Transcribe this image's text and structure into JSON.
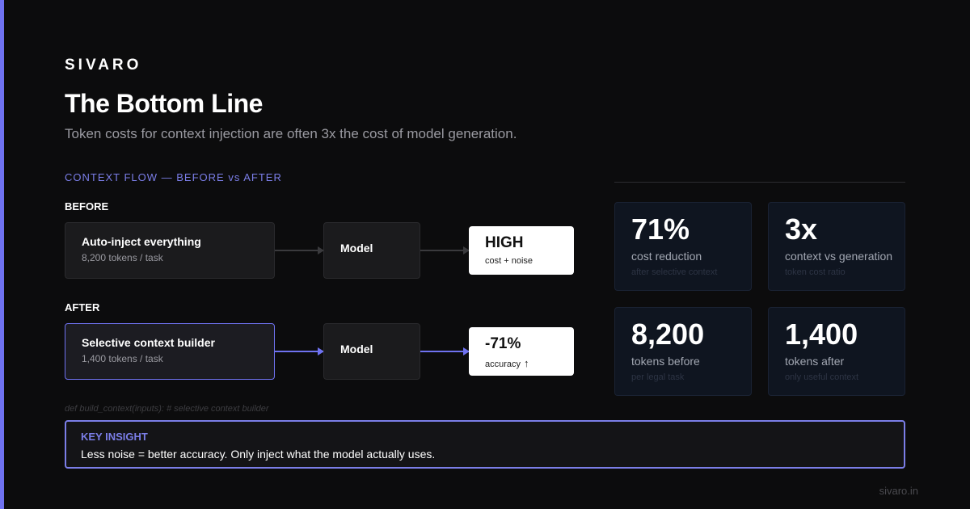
{
  "brand": "SIVARO",
  "title": "The Bottom Line",
  "subtitle": "Token costs for context injection are often 3x the cost of model generation.",
  "flow": {
    "section_label": "CONTEXT FLOW — BEFORE vs AFTER",
    "before": {
      "label": "BEFORE",
      "source_title": "Auto-inject everything",
      "source_sub": "8,200 tokens / task",
      "model": "Model",
      "result_big": "HIGH",
      "result_small": "cost + noise"
    },
    "after": {
      "label": "AFTER",
      "source_title": "Selective context builder",
      "source_sub": "1,400 tokens / task",
      "model": "Model",
      "result_big": "-71%",
      "result_small": "accuracy",
      "result_arrow": "↑"
    }
  },
  "code_hint": "def build_context(inputs): # selective context builder",
  "stats": [
    {
      "value": "71%",
      "label": "cost reduction",
      "note": "after selective context"
    },
    {
      "value": "3x",
      "label": "context vs generation",
      "note": "token cost ratio"
    },
    {
      "value": "8,200",
      "label": "tokens before",
      "note": "per legal task"
    },
    {
      "value": "1,400",
      "label": "tokens after",
      "note": "only useful context"
    }
  ],
  "insight": {
    "title": "KEY INSIGHT",
    "text": "Less noise = better accuracy. Only inject what the model actually uses."
  },
  "footer": "sivaro.in",
  "colors": {
    "accent": "#6f72f0",
    "background": "#0c0c0d",
    "stat_bg": "#0f1520"
  }
}
